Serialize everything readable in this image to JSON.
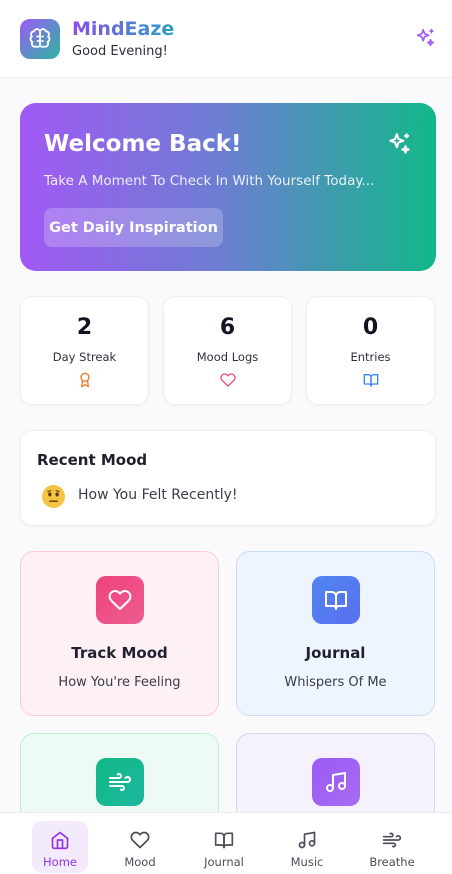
{
  "header": {
    "app_title": "MindEaze",
    "greeting": "Good Evening!",
    "logo_icon": "brain-icon",
    "action_icon": "sparkles-icon"
  },
  "banner": {
    "title": "Welcome Back!",
    "subtitle": "Take A Moment To Check In With Yourself Today...",
    "button_label": "Get Daily Inspiration",
    "icon": "sparkles-icon"
  },
  "stats": [
    {
      "value": "2",
      "label": "Day Streak",
      "icon": "award-icon",
      "color": "#ea7a28"
    },
    {
      "value": "6",
      "label": "Mood Logs",
      "icon": "heart-icon",
      "color": "#ec4c7e"
    },
    {
      "value": "0",
      "label": "Entries",
      "icon": "book-open-icon",
      "color": "#3b82f6"
    }
  ],
  "recent_mood": {
    "title": "Recent Mood",
    "emoji_icon": "uncertain-face-icon",
    "text": "How You Felt Recently!"
  },
  "cards": [
    {
      "title": "Track Mood",
      "subtitle": "How You're Feeling",
      "icon": "heart-icon"
    },
    {
      "title": "Journal",
      "subtitle": "Whispers Of Me",
      "icon": "book-open-icon"
    },
    {
      "title": "",
      "subtitle": "",
      "icon": "wind-icon"
    },
    {
      "title": "",
      "subtitle": "",
      "icon": "music-icon"
    }
  ],
  "bottom_nav": [
    {
      "label": "Home",
      "icon": "home-icon",
      "active": true
    },
    {
      "label": "Mood",
      "icon": "heart-icon",
      "active": false
    },
    {
      "label": "Journal",
      "icon": "book-open-icon",
      "active": false
    },
    {
      "label": "Music",
      "icon": "music-icon",
      "active": false
    },
    {
      "label": "Breathe",
      "icon": "wind-icon",
      "active": false
    }
  ],
  "colors": {
    "accent": "#9333ea",
    "banner_start": "#a259f5",
    "banner_end": "#12b88a"
  }
}
